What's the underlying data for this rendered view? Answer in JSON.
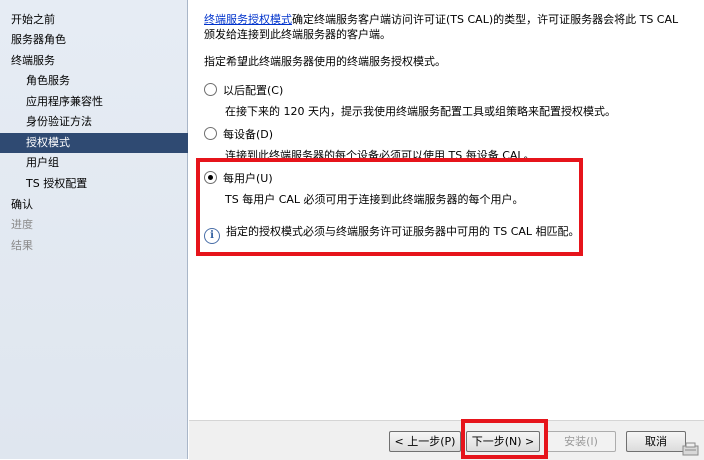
{
  "sidebar": {
    "items": [
      {
        "label": "开始之前",
        "level": 0,
        "state": "normal"
      },
      {
        "label": "服务器角色",
        "level": 0,
        "state": "normal"
      },
      {
        "label": "终端服务",
        "level": 0,
        "state": "normal"
      },
      {
        "label": "角色服务",
        "level": 1,
        "state": "normal"
      },
      {
        "label": "应用程序兼容性",
        "level": 1,
        "state": "normal"
      },
      {
        "label": "身份验证方法",
        "level": 1,
        "state": "normal"
      },
      {
        "label": "授权模式",
        "level": 1,
        "state": "selected"
      },
      {
        "label": "用户组",
        "level": 1,
        "state": "normal"
      },
      {
        "label": "TS 授权配置",
        "level": 1,
        "state": "normal"
      },
      {
        "label": "确认",
        "level": 0,
        "state": "normal"
      },
      {
        "label": "进度",
        "level": 0,
        "state": "disabled"
      },
      {
        "label": "结果",
        "level": 0,
        "state": "disabled"
      }
    ]
  },
  "main": {
    "intro_link": "终端服务授权模式",
    "intro_line1": "确定终端服务客户端访问许可证(TS CAL)的类型，许可证服务器会将此 TS CAL",
    "intro_line2": "颁发给连接到此终端服务器的客户端。",
    "prompt": "指定希望此终端服务器使用的终端服务授权模式。",
    "options": [
      {
        "label": "以后配置(C)",
        "description": "在接下来的 120 天内，提示我使用终端服务配置工具或组策略来配置授权模式。",
        "selected": false
      },
      {
        "label": "每设备(D)",
        "description": "连接到此终端服务器的每个设备必须可以使用 TS 每设备 CAL。",
        "selected": false
      },
      {
        "label": "每用户(U)",
        "description": "TS 每用户 CAL 必须可用于连接到此终端服务器的每个用户。",
        "selected": true
      }
    ],
    "info_text": "指定的授权模式必须与终端服务许可证服务器中可用的 TS CAL 相匹配。"
  },
  "footer": {
    "prev_label": "< 上一步(P)",
    "next_label": "下一步(N) >",
    "install_label": "安装(I)",
    "cancel_label": "取消"
  },
  "colors": {
    "highlight": "#e6141b",
    "selected_nav": "#2f4a72",
    "link": "#0033cc"
  }
}
